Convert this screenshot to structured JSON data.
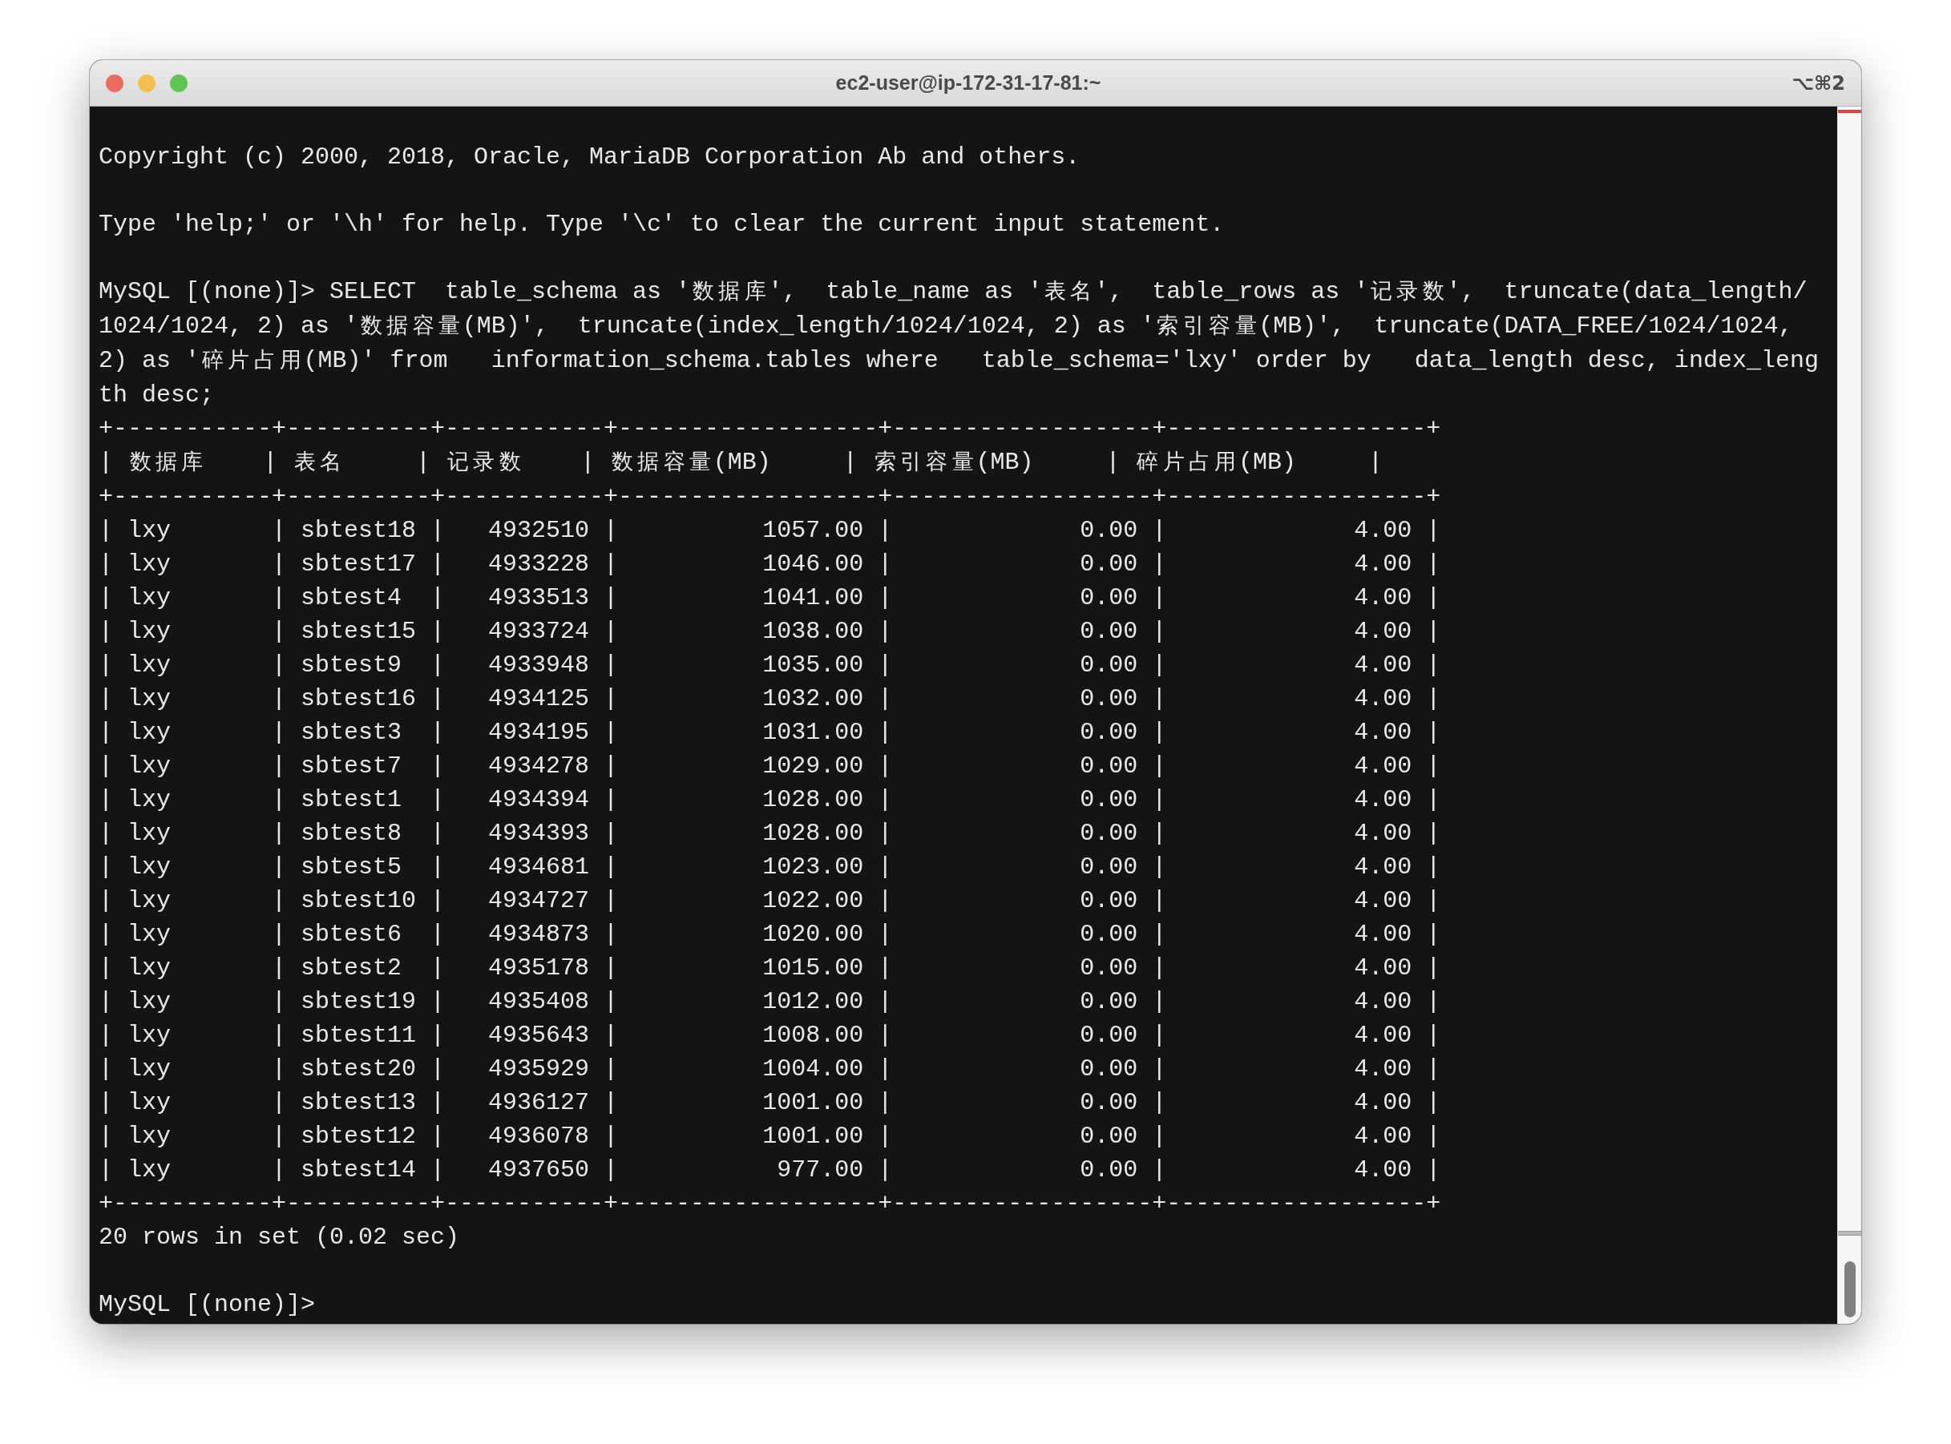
{
  "window": {
    "title": "ec2-user@ip-172-31-17-81:~",
    "shortcut": "⌥⌘2"
  },
  "terminal": {
    "blocks": [
      {
        "lines": [
          "Copyright (c) 2000, 2018, Oracle, MariaDB Corporation Ab and others."
        ]
      },
      {
        "lines": [
          "Type 'help;' or '\\h' for help. Type '\\c' to clear the current input statement."
        ]
      },
      {
        "lines": [
          "MySQL [(none)]> SELECT  table_schema as '数据库',  table_name as '表名',  table_rows as '记录数',  truncate(data_length/",
          "1024/1024, 2) as '数据容量(MB)',  truncate(index_length/1024/1024, 2) as '索引容量(MB)',  truncate(DATA_FREE/1024/1024,",
          "2) as '碎片占用(MB)' from   information_schema.tables where   table_schema='lxy' order by   data_length desc, index_leng",
          "th desc;",
          "+-----------+----------+-----------+------------------+------------------+------------------+",
          "| 数据库    | 表名     | 记录数    | 数据容量(MB)     | 索引容量(MB)     | 碎片占用(MB)     |",
          "+-----------+----------+-----------+------------------+------------------+------------------+",
          "| lxy       | sbtest18 |   4932510 |          1057.00 |             0.00 |             4.00 |",
          "| lxy       | sbtest17 |   4933228 |          1046.00 |             0.00 |             4.00 |",
          "| lxy       | sbtest4  |   4933513 |          1041.00 |             0.00 |             4.00 |",
          "| lxy       | sbtest15 |   4933724 |          1038.00 |             0.00 |             4.00 |",
          "| lxy       | sbtest9  |   4933948 |          1035.00 |             0.00 |             4.00 |",
          "| lxy       | sbtest16 |   4934125 |          1032.00 |             0.00 |             4.00 |",
          "| lxy       | sbtest3  |   4934195 |          1031.00 |             0.00 |             4.00 |",
          "| lxy       | sbtest7  |   4934278 |          1029.00 |             0.00 |             4.00 |",
          "| lxy       | sbtest1  |   4934394 |          1028.00 |             0.00 |             4.00 |",
          "| lxy       | sbtest8  |   4934393 |          1028.00 |             0.00 |             4.00 |",
          "| lxy       | sbtest5  |   4934681 |          1023.00 |             0.00 |             4.00 |",
          "| lxy       | sbtest10 |   4934727 |          1022.00 |             0.00 |             4.00 |",
          "| lxy       | sbtest6  |   4934873 |          1020.00 |             0.00 |             4.00 |",
          "| lxy       | sbtest2  |   4935178 |          1015.00 |             0.00 |             4.00 |",
          "| lxy       | sbtest19 |   4935408 |          1012.00 |             0.00 |             4.00 |",
          "| lxy       | sbtest11 |   4935643 |          1008.00 |             0.00 |             4.00 |",
          "| lxy       | sbtest20 |   4935929 |          1004.00 |             0.00 |             4.00 |",
          "| lxy       | sbtest13 |   4936127 |          1001.00 |             0.00 |             4.00 |",
          "| lxy       | sbtest12 |   4936078 |          1001.00 |             0.00 |             4.00 |",
          "| lxy       | sbtest14 |   4937650 |           977.00 |             0.00 |             4.00 |",
          "+-----------+----------+-----------+------------------+------------------+------------------+",
          "20 rows in set (0.02 sec)"
        ]
      },
      {
        "lines": [
          "MySQL [(none)]> "
        ]
      }
    ]
  }
}
